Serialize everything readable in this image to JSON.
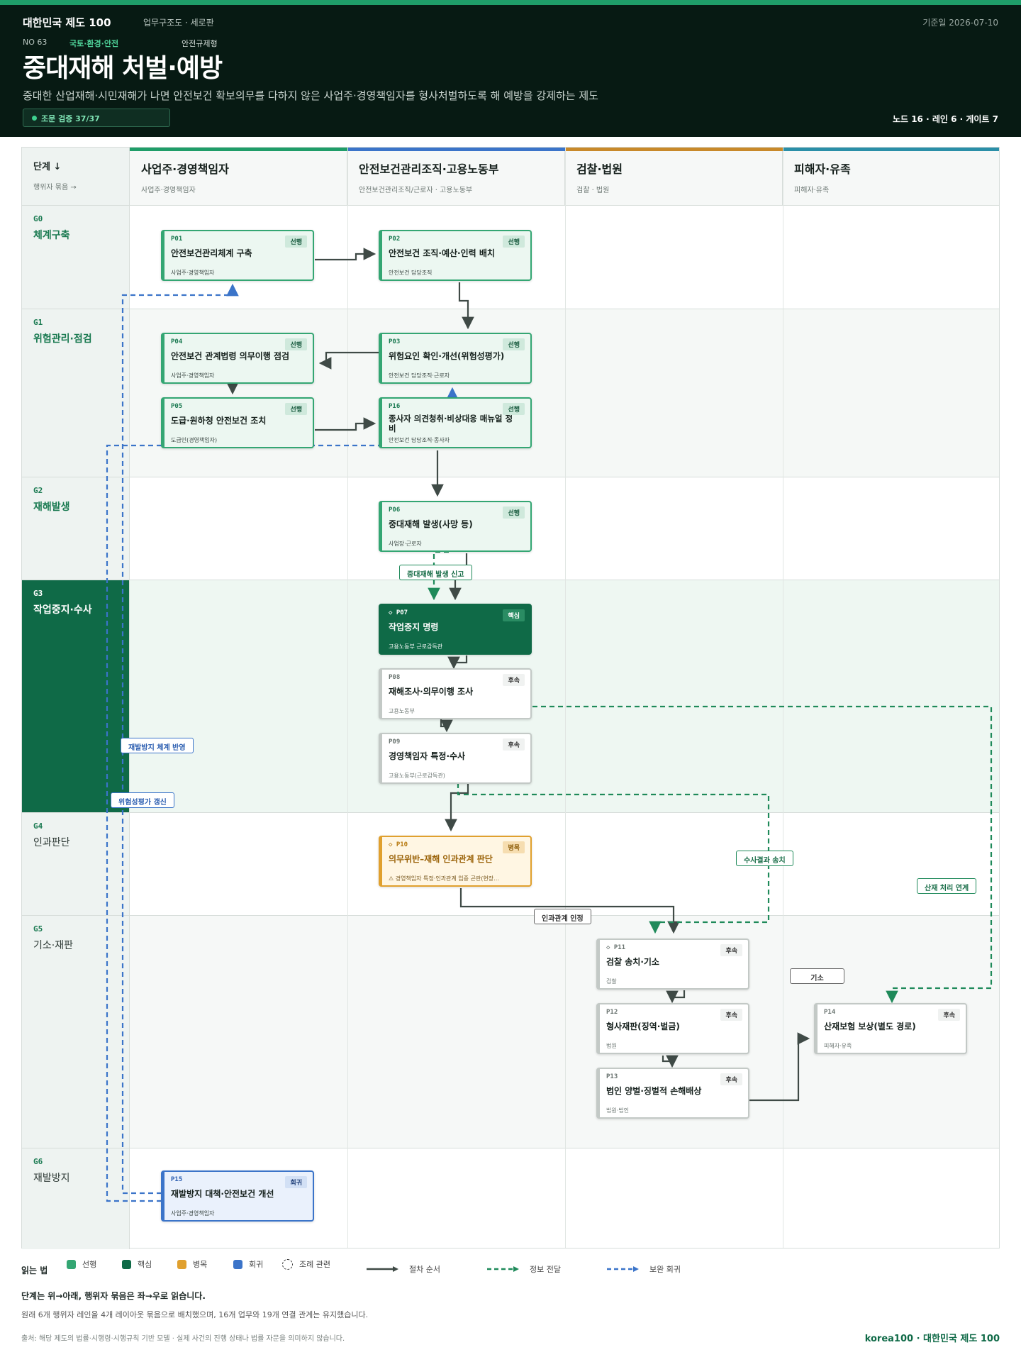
{
  "header": {
    "brand": "대한민국 제도 100",
    "view": "업무구조도 · 세로판",
    "ref_date": "기준일 2026-07-10",
    "no": "NO 63",
    "category": "국토·환경·안전",
    "type": "안전규제형",
    "title": "중대재해 처벌·예방",
    "subtitle": "중대한 산업재해·시민재해가 나면 안전보건 확보의무를 다하지 않은 사업주·경영책임자를 형사처벌하도록 해 예방을 강제하는 제도",
    "verify": "조문 검증 37/37",
    "stats": "노드 16 · 레인 6 · 게이트 7"
  },
  "corner": {
    "title": "단계 ↓",
    "sub": "행위자 묶음 →"
  },
  "lanes": [
    {
      "title": "사업주·경영책임자",
      "sub": "사업주·경영책임자",
      "color": "#1f9d69"
    },
    {
      "title": "안전보건관리조직·고용노동부",
      "sub": "안전보건관리조직/근로자 · 고용노동부",
      "color": "#3b74c9"
    },
    {
      "title": "검찰·법원",
      "sub": "검찰 · 법원",
      "color": "#c8892a"
    },
    {
      "title": "피해자·유족",
      "sub": "피해자·유족",
      "color": "#2a8fa8"
    }
  ],
  "stages": [
    {
      "id": "G0",
      "name": "체계구축"
    },
    {
      "id": "G1",
      "name": "위험관리·점검"
    },
    {
      "id": "G2",
      "name": "재해발생"
    },
    {
      "id": "G3",
      "name": "작업중지·수사"
    },
    {
      "id": "G4",
      "name": "인과판단"
    },
    {
      "id": "G5",
      "name": "기소·재판"
    },
    {
      "id": "G6",
      "name": "재발방지"
    }
  ],
  "nodes": {
    "p01": {
      "id": "P01",
      "tag": "선행",
      "title": "안전보건관리체계 구축",
      "actor": "사업주·경영책임자"
    },
    "p02": {
      "id": "P02",
      "tag": "선행",
      "title": "안전보건 조직·예산·인력 배치",
      "actor": "안전보건 담당조직"
    },
    "p04": {
      "id": "P04",
      "tag": "선행",
      "title": "안전보건 관계법령 의무이행 점검",
      "actor": "사업주·경영책임자"
    },
    "p03": {
      "id": "P03",
      "tag": "선행",
      "title": "위험요인 확인·개선(위험성평가)",
      "actor": "안전보건 담당조직·근로자"
    },
    "p05": {
      "id": "P05",
      "tag": "선행",
      "title": "도급·원하청 안전보건 조치",
      "actor": "도급인(경영책임자)"
    },
    "p16": {
      "id": "P16",
      "tag": "선행",
      "title": "종사자 의견청취·비상대응 매뉴얼 정비",
      "actor": "안전보건 담당조직·종사자"
    },
    "p06": {
      "id": "P06",
      "tag": "선행",
      "title": "중대재해 발생(사망 등)",
      "actor": "사업장·근로자"
    },
    "p07": {
      "id": "◇ P07",
      "tag": "핵심",
      "title": "작업중지 명령",
      "actor": "고용노동부 근로감독관"
    },
    "p08": {
      "id": "P08",
      "tag": "후속",
      "title": "재해조사·의무이행 조사",
      "actor": "고용노동부"
    },
    "p09": {
      "id": "P09",
      "tag": "후속",
      "title": "경영책임자 특정·수사",
      "actor": "고용노동부(근로감독관)"
    },
    "p10": {
      "id": "◇ P10",
      "tag": "병목",
      "title": "의무위반–재해 인과관계 판단",
      "actor": "⚠ 경영책임자 특정·인과관계 입증 곤란(현장…"
    },
    "p11": {
      "id": "◇ P11",
      "tag": "후속",
      "title": "검찰 송치·기소",
      "actor": "검찰"
    },
    "p12": {
      "id": "P12",
      "tag": "후속",
      "title": "형사재판(징역·벌금)",
      "actor": "법원"
    },
    "p13": {
      "id": "P13",
      "tag": "후속",
      "title": "법인 양벌·징벌적 손해배상",
      "actor": "법원·법인"
    },
    "p14": {
      "id": "P14",
      "tag": "후속",
      "title": "산재보험 보상(별도 경로)",
      "actor": "피해자·유족"
    },
    "p15": {
      "id": "P15",
      "tag": "회귀",
      "title": "재발방지 대책·안전보건 개선",
      "actor": "사업주·경영책임자"
    }
  },
  "edge_labels": {
    "report": "중대재해 발생 신고",
    "reflect": "재발방지 체계 반영",
    "renew": "위험성평가 갱신",
    "referral": "수사결과 송치",
    "sanjae": "산재 처리 연계",
    "causal": "인과관계 인정",
    "indict": "기소"
  },
  "legend": {
    "title": "읽는 법",
    "prior": "선행",
    "core": "핵심",
    "bottleneck": "병목",
    "feedback": "회귀",
    "ordinance": "조례 관련",
    "seq": "절차 순서",
    "info": "정보 전달",
    "loop": "보완 회귀",
    "colors": {
      "prior": "#34a673",
      "core": "#0f6a47",
      "bottleneck": "#e0a02e",
      "feedback": "#3b74c9"
    }
  },
  "notes": {
    "line1": "단계는 위→아래, 행위자 묶음은 좌→우로 읽습니다.",
    "line2": "원래 6개 행위자 레인을 4개 레이아웃 묶음으로 배치했으며, 16개 업무와 19개 연결 관계는 유지했습니다."
  },
  "footer": {
    "source": "출처: 해당 제도의 법률·시행령·시행규칙 기반 모델 · 실제 사건의 진행 상태나 법률 자문을 의미하지 않습니다.",
    "brand": "korea100 · 대한민국 제도 100"
  }
}
